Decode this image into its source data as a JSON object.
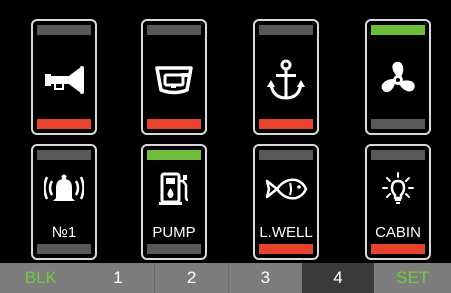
{
  "colors": {
    "off": "#585858",
    "on_green": "#6fbe3b",
    "on_red": "#e8432e",
    "bar_dark": "#3a3a3a",
    "bar_light": "#7d7d7d",
    "bar_active_text": "#6ccc3d"
  },
  "tiles": [
    {
      "icon": "horn-icon",
      "label": "",
      "top": "off",
      "bottom": "on_red"
    },
    {
      "icon": "bilge-pump-icon",
      "label": "",
      "top": "off",
      "bottom": "on_red"
    },
    {
      "icon": "anchor-icon",
      "label": "",
      "top": "off",
      "bottom": "on_red"
    },
    {
      "icon": "fan-icon",
      "label": "",
      "top": "on_green",
      "bottom": "off"
    },
    {
      "icon": "bell-icon",
      "label": "№1",
      "top": "off",
      "bottom": "off"
    },
    {
      "icon": "fuel-pump-icon",
      "label": "PUMP",
      "top": "on_green",
      "bottom": "off"
    },
    {
      "icon": "fish-icon",
      "label": "L.WELL",
      "top": "off",
      "bottom": "on_red"
    },
    {
      "icon": "light-bulb-icon",
      "label": "CABIN",
      "top": "off",
      "bottom": "on_red"
    }
  ],
  "bottom_bar": {
    "blk": "BLK",
    "page1": "1",
    "page2": "2",
    "page3": "3",
    "page4": "4",
    "set": "SET"
  }
}
